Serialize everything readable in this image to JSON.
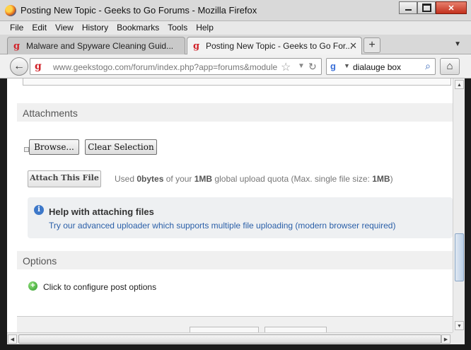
{
  "window": {
    "title": "Posting New Topic - Geeks to Go Forums - Mozilla Firefox",
    "app_icon": "firefox-icon"
  },
  "menu": [
    "File",
    "Edit",
    "View",
    "History",
    "Bookmarks",
    "Tools",
    "Help"
  ],
  "tabs": [
    {
      "label": "Malware and Spyware Cleaning Guid...",
      "active": false
    },
    {
      "label": "Posting New Topic - Geeks to Go For...",
      "active": true
    }
  ],
  "navbar": {
    "url": "www.geekstogo.com/forum/index.php?app=forums&module",
    "search_query": "dialauge box",
    "search_engine": "google-icon"
  },
  "attachments": {
    "heading": "Attachments",
    "browse_label": "Browse...",
    "clear_label": "Clear Selection",
    "attach_label": "Attach This File",
    "quota": {
      "prefix": "Used ",
      "used": "0bytes",
      "mid": " of your ",
      "limit": "1MB",
      "suffix_a": " global upload quota (Max. single file size: ",
      "max_file": "1MB",
      "suffix_b": ")"
    },
    "help": {
      "title": "Help with attaching files",
      "link": "Try our advanced uploader which supports multiple file uploading (modern browser required)"
    }
  },
  "options": {
    "heading": "Options",
    "configure_label": "Click to configure post options"
  },
  "colors": {
    "accent_link": "#2a5fa8",
    "brand_red": "#d1232a",
    "section_bg": "#f0f0f0"
  }
}
